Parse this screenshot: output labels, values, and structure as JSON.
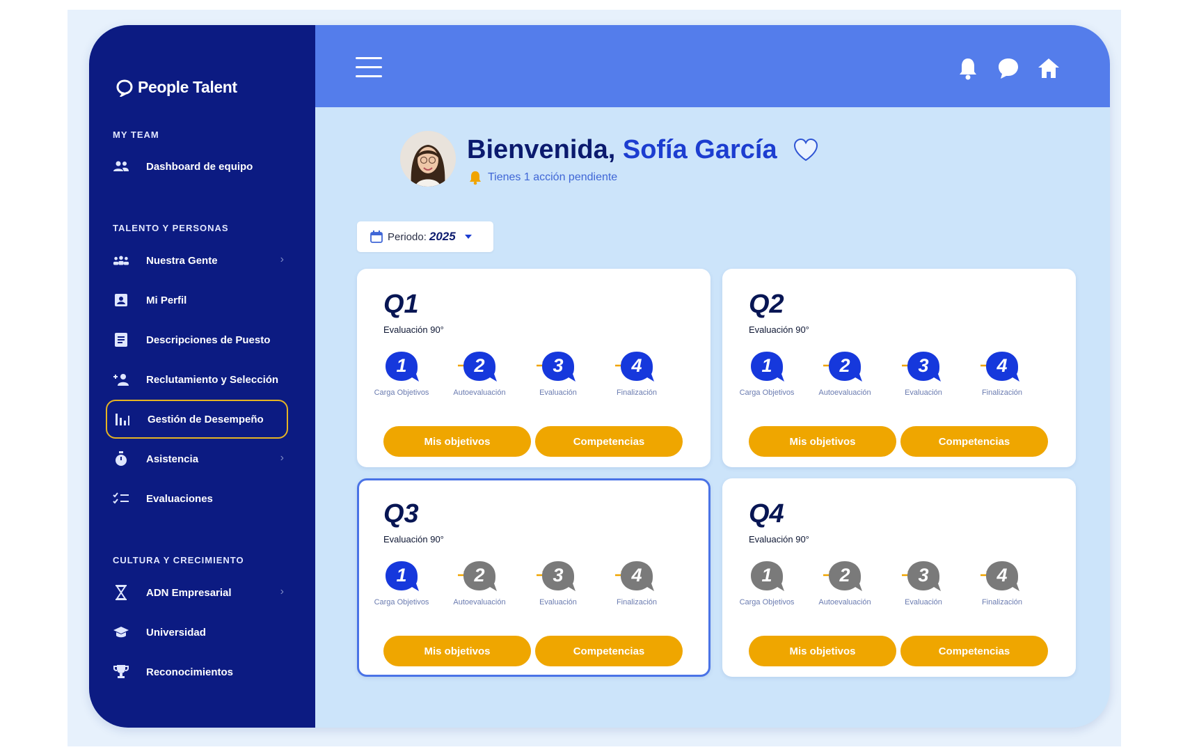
{
  "brand": {
    "name": "People Talent"
  },
  "sidebar": {
    "sections": [
      {
        "title": "MY TEAM"
      },
      {
        "title": "TALENTO Y PERSONAS"
      },
      {
        "title": "CULTURA Y CRECIMIENTO"
      }
    ],
    "items": [
      {
        "label": "Dashboard de equipo",
        "icon": "team-icon"
      },
      {
        "label": "Nuestra Gente",
        "icon": "people-icon",
        "has_submenu": true
      },
      {
        "label": "Mi Perfil",
        "icon": "profile-card-icon"
      },
      {
        "label": "Descripciones de Puesto",
        "icon": "document-icon"
      },
      {
        "label": "Reclutamiento y Selección",
        "icon": "add-person-icon"
      },
      {
        "label": "Gestión de Desempeño",
        "icon": "performance-bars-icon",
        "active": true
      },
      {
        "label": "Asistencia",
        "icon": "stopwatch-icon",
        "has_submenu": true
      },
      {
        "label": "Evaluaciones",
        "icon": "checklist-icon"
      },
      {
        "label": "ADN Empresarial",
        "icon": "hourglass-icon",
        "has_submenu": true
      },
      {
        "label": "Universidad",
        "icon": "graduation-cap-icon"
      },
      {
        "label": "Reconocimientos",
        "icon": "trophy-icon"
      }
    ]
  },
  "header": {
    "icons": [
      "bell-icon",
      "chat-icon",
      "home-icon"
    ]
  },
  "welcome": {
    "greeting": "Bienvenida, ",
    "name": "Sofía García",
    "pending": "Tienes 1 acción pendiente"
  },
  "period": {
    "label": "Periodo:",
    "value": "2025"
  },
  "cards": [
    {
      "title": "Q1",
      "subtitle": "Evaluación 90°",
      "steps_active": [
        true,
        true,
        true,
        true
      ],
      "selected": false
    },
    {
      "title": "Q2",
      "subtitle": "Evaluación 90°",
      "steps_active": [
        true,
        true,
        true,
        true
      ],
      "selected": false
    },
    {
      "title": "Q3",
      "subtitle": "Evaluación 90°",
      "steps_active": [
        true,
        false,
        false,
        false
      ],
      "selected": true
    },
    {
      "title": "Q4",
      "subtitle": "Evaluación 90°",
      "steps_active": [
        false,
        false,
        false,
        false
      ],
      "selected": false
    }
  ],
  "steps": [
    {
      "number": "1",
      "label": "Carga Objetivos"
    },
    {
      "number": "2",
      "label": "Autoevaluación"
    },
    {
      "number": "3",
      "label": "Evaluación"
    },
    {
      "number": "4",
      "label": "Finalización"
    }
  ],
  "buttons": {
    "objectives": "Mis objetivos",
    "competencies": "Competencias"
  },
  "colors": {
    "sidebar": "#0c1b82",
    "header": "#547deb",
    "content": "#cce4fa",
    "step_active": "#1638dc",
    "step_inactive": "#7a7a7a",
    "accent": "#efa600",
    "arrow": "#f0a400",
    "active_outline": "#e6b423"
  }
}
